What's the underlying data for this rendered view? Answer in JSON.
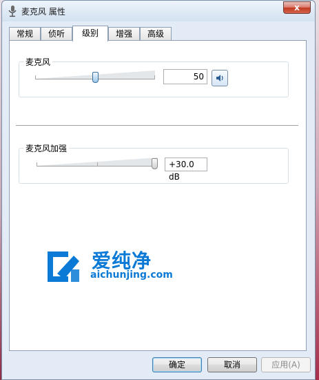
{
  "window": {
    "title": "麦克风 属性",
    "close_label": "x"
  },
  "tabs": [
    {
      "label": "常规"
    },
    {
      "label": "侦听"
    },
    {
      "label": "级别",
      "active": true
    },
    {
      "label": "增强"
    },
    {
      "label": "高级"
    }
  ],
  "microphone": {
    "label": "麦克风",
    "value": "50",
    "level_percent": 50
  },
  "boost": {
    "label": "麦克风加强",
    "value": "+30.0 dB",
    "level_percent": 100
  },
  "watermark": {
    "brand_cn": "爱纯净",
    "brand_en": "aichunjing.com"
  },
  "buttons": {
    "ok": "确定",
    "cancel": "取消",
    "apply": "应用(A)"
  },
  "colors": {
    "accent": "#0b7ad6",
    "window_bg": "#e3ecf6",
    "close": "#c23a22"
  }
}
